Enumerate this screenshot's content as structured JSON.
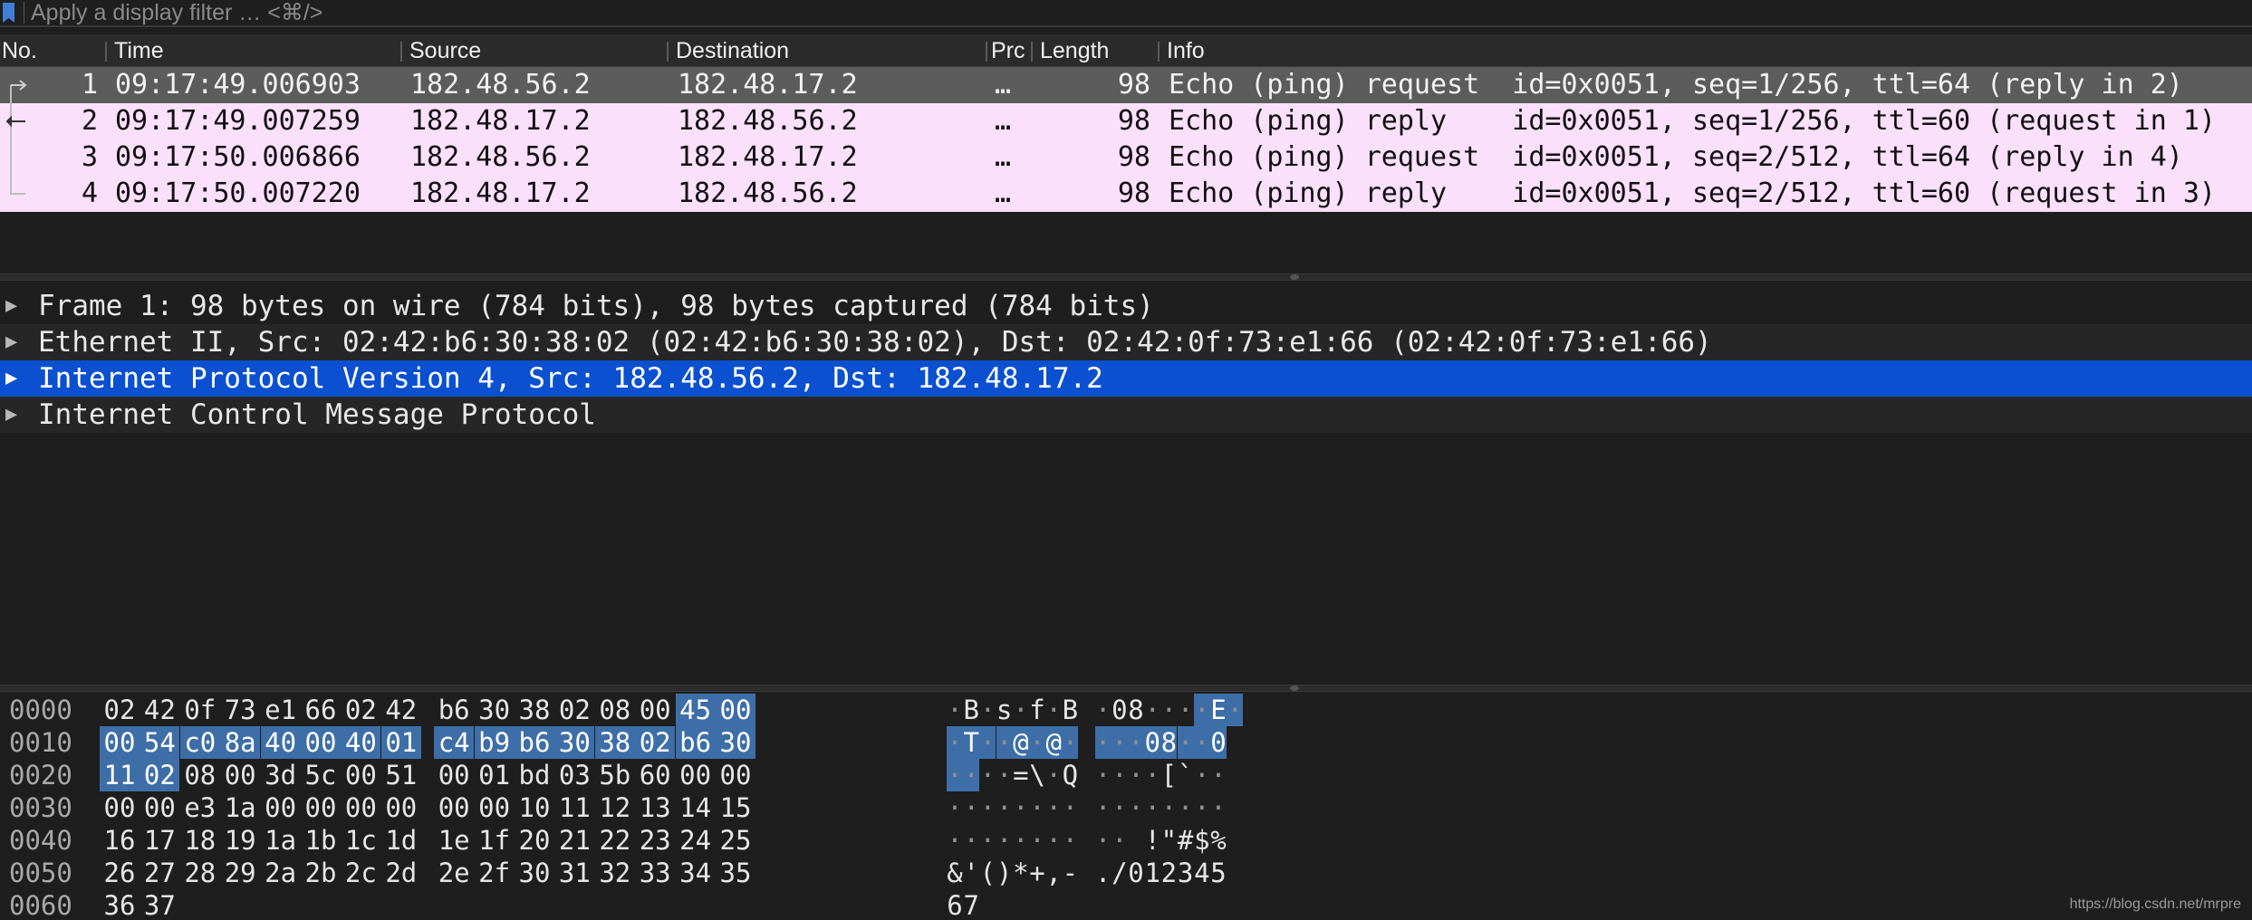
{
  "filter": {
    "placeholder": "Apply a display filter … <⌘/>"
  },
  "columns": [
    "No.",
    "Time",
    "Source",
    "Destination",
    "Prc",
    "Length",
    "Info"
  ],
  "packets": [
    {
      "no": "1",
      "time": "09:17:49.006903",
      "source": "182.48.56.2",
      "destination": "182.48.17.2",
      "protocol": "…",
      "length": "98",
      "info": "Echo (ping) request  id=0x0051, seq=1/256, ttl=64 (reply in 2)"
    },
    {
      "no": "2",
      "time": "09:17:49.007259",
      "source": "182.48.17.2",
      "destination": "182.48.56.2",
      "protocol": "…",
      "length": "98",
      "info": "Echo (ping) reply    id=0x0051, seq=1/256, ttl=60 (request in 1)"
    },
    {
      "no": "3",
      "time": "09:17:50.006866",
      "source": "182.48.56.2",
      "destination": "182.48.17.2",
      "protocol": "…",
      "length": "98",
      "info": "Echo (ping) request  id=0x0051, seq=2/512, ttl=64 (reply in 4)"
    },
    {
      "no": "4",
      "time": "09:17:50.007220",
      "source": "182.48.17.2",
      "destination": "182.48.56.2",
      "protocol": "…",
      "length": "98",
      "info": "Echo (ping) reply    id=0x0051, seq=2/512, ttl=60 (request in 3)"
    }
  ],
  "selected_packet": "1",
  "details": [
    {
      "text": "Frame 1: 98 bytes on wire (784 bits), 98 bytes captured (784 bits)",
      "selected": false
    },
    {
      "text": "Ethernet II, Src: 02:42:b6:30:38:02 (02:42:b6:30:38:02), Dst: 02:42:0f:73:e1:66 (02:42:0f:73:e1:66)",
      "selected": false
    },
    {
      "text": "Internet Protocol Version 4, Src: 182.48.56.2, Dst: 182.48.17.2",
      "selected": true
    },
    {
      "text": "Internet Control Message Protocol",
      "selected": false
    }
  ],
  "bytes": [
    {
      "offset": "0000",
      "hex": [
        "02",
        "42",
        "0f",
        "73",
        "e1",
        "66",
        "02",
        "42",
        "b6",
        "30",
        "38",
        "02",
        "08",
        "00",
        "45",
        "00"
      ],
      "ascii": "·B·s·f·B·08····E·"
    },
    {
      "offset": "0010",
      "hex": [
        "00",
        "54",
        "c0",
        "8a",
        "40",
        "00",
        "40",
        "01",
        "c4",
        "b9",
        "b6",
        "30",
        "38",
        "02",
        "b6",
        "30"
      ],
      "ascii": "·T··@·@····08··0"
    },
    {
      "offset": "0020",
      "hex": [
        "11",
        "02",
        "08",
        "00",
        "3d",
        "5c",
        "00",
        "51",
        "00",
        "01",
        "bd",
        "03",
        "5b",
        "60",
        "00",
        "00"
      ],
      "ascii": "····=\\·Q····[`··"
    },
    {
      "offset": "0030",
      "hex": [
        "00",
        "00",
        "e3",
        "1a",
        "00",
        "00",
        "00",
        "00",
        "00",
        "00",
        "10",
        "11",
        "12",
        "13",
        "14",
        "15"
      ],
      "ascii": "················"
    },
    {
      "offset": "0040",
      "hex": [
        "16",
        "17",
        "18",
        "19",
        "1a",
        "1b",
        "1c",
        "1d",
        "1e",
        "1f",
        "20",
        "21",
        "22",
        "23",
        "24",
        "25"
      ],
      "ascii": "·········· !\"#$%"
    },
    {
      "offset": "0050",
      "hex": [
        "26",
        "27",
        "28",
        "29",
        "2a",
        "2b",
        "2c",
        "2d",
        "2e",
        "2f",
        "30",
        "31",
        "32",
        "33",
        "34",
        "35"
      ],
      "ascii": "&'()*+,-./012345"
    },
    {
      "offset": "0060",
      "hex": [
        "36",
        "37"
      ],
      "ascii": "67"
    }
  ],
  "highlight_bytes": {
    "start": 14,
    "end": 34
  },
  "watermark": "https://blog.csdn.net/mrpre",
  "colors": {
    "selected_detail": "#0a50d0",
    "icmp_row": "#fbe0fb",
    "selected_row": "#5c5c5c",
    "byte_highlight": "#3d6ea8"
  },
  "icons": {
    "filter_bookmark": "bookmark-icon",
    "expand": "disclosure-triangle-icon"
  }
}
